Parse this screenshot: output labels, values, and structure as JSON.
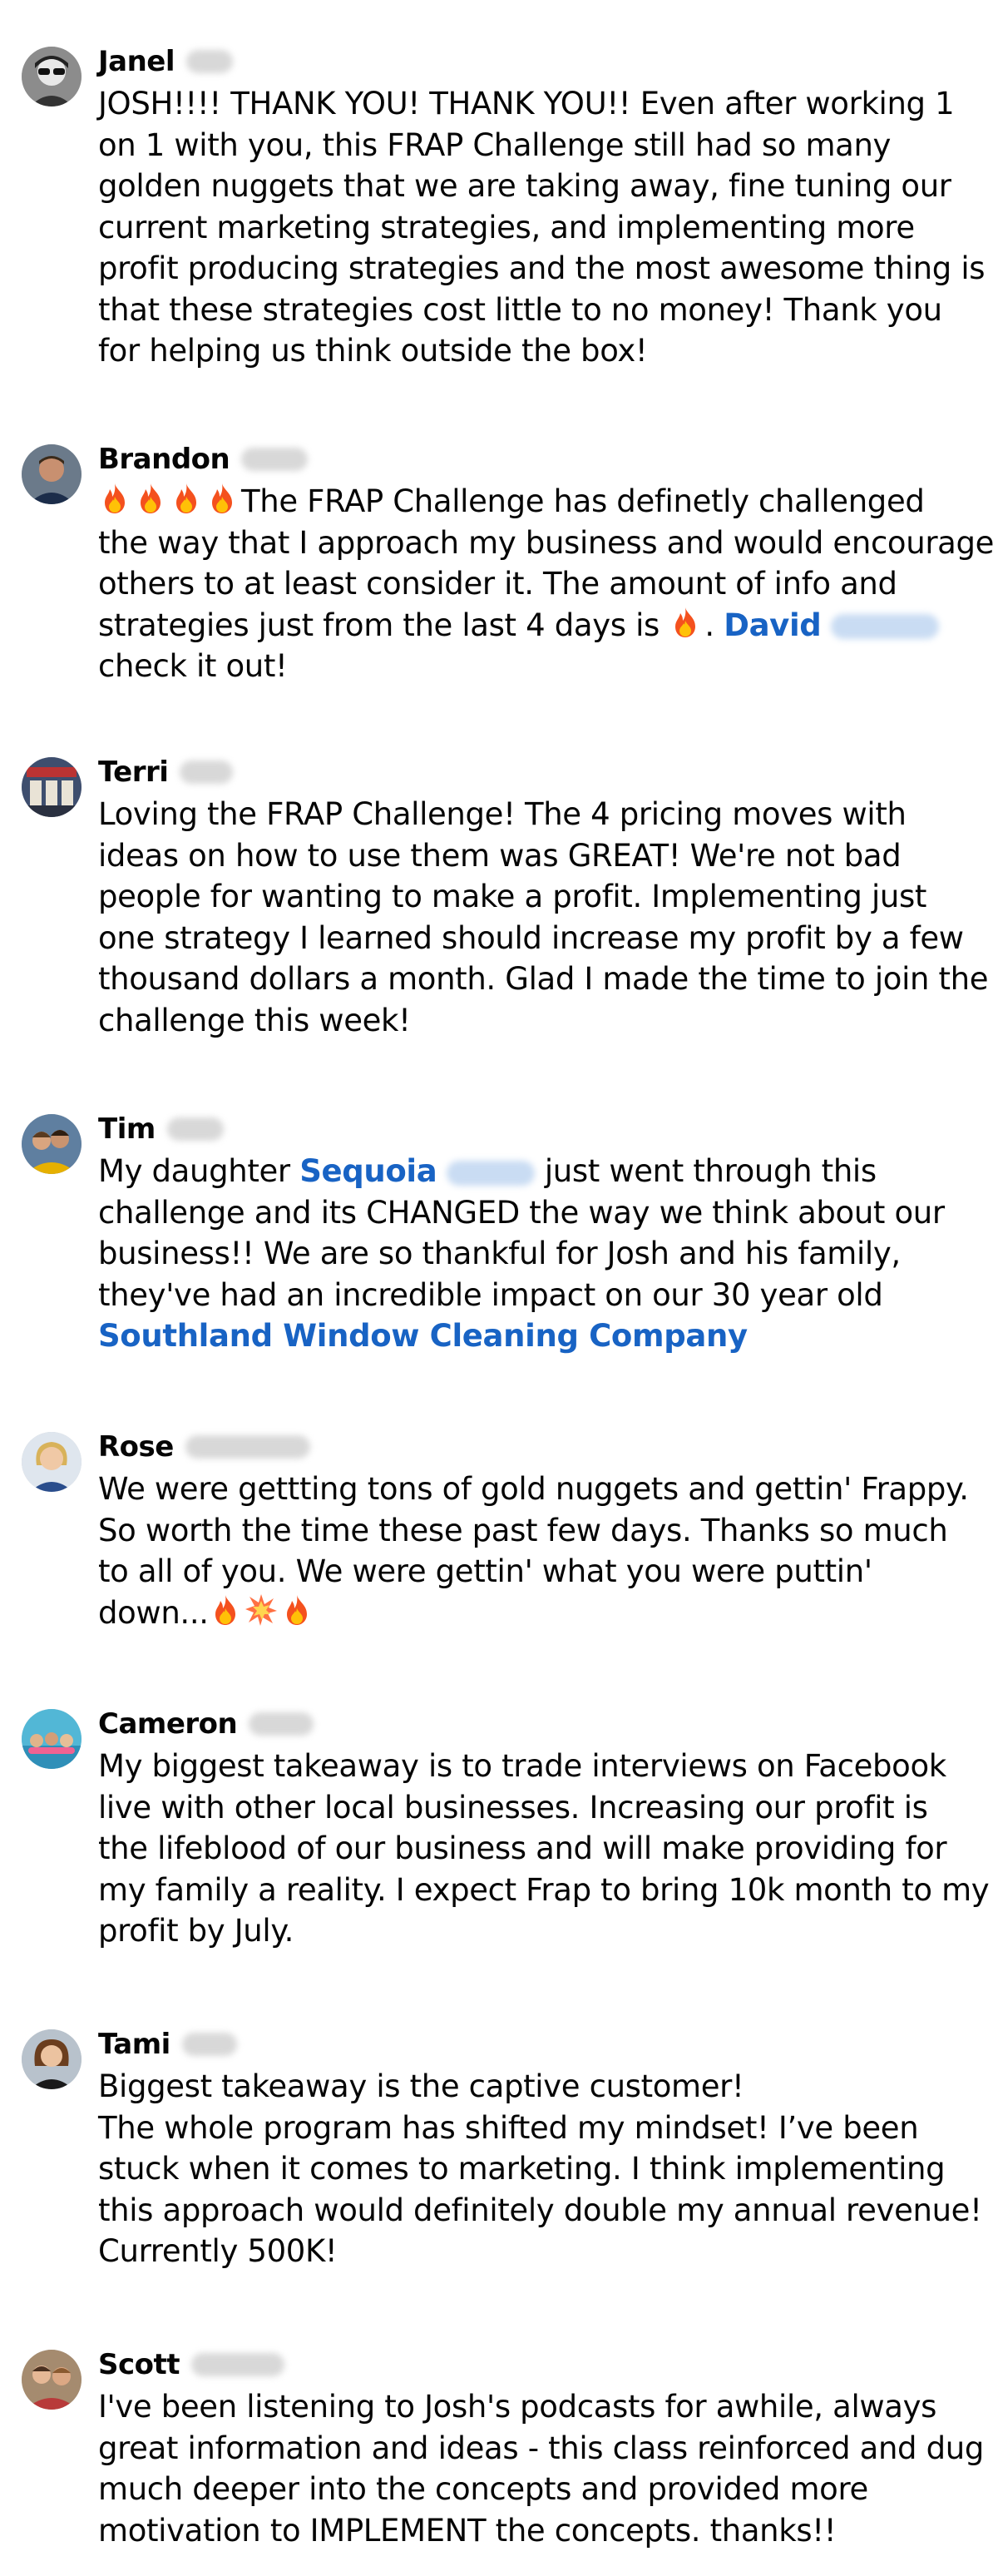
{
  "comments": [
    {
      "author": "Janel",
      "avatar": "avatar-sunglasses",
      "lines": [
        "JOSH!!!! THANK YOU! THANK YOU!! Even after working 1",
        "on 1 with you, this FRAP Challenge still had so many",
        "golden nuggets that we are taking away, fine tuning our",
        "current marketing strategies, and implementing more",
        "profit producing strategies and the most awesome thing is",
        "that these strategies cost little to no money! Thank you",
        "for helping us think outside the box!"
      ]
    },
    {
      "author": "Brandon",
      "avatar": "avatar-man",
      "line1_text": "The FRAP Challenge has definetly challenged",
      "line2": "the way that I approach my business and would encourage",
      "line3": "others to at least consider it. The amount of info and",
      "line4_text": "strategies just from the last 4 days is",
      "line4_period": ".",
      "mention": "David",
      "line5": "check it out!"
    },
    {
      "author": "Terri",
      "avatar": "avatar-store",
      "lines": [
        "Loving the FRAP Challenge! The 4 pricing moves with",
        "ideas on how to use them was GREAT! We're not bad",
        "people for wanting to make a profit. Implementing just",
        "one strategy I learned should increase my profit by a few",
        "thousand dollars a month. Glad I made the time to join the",
        "challenge this week!"
      ]
    },
    {
      "author": "Tim",
      "avatar": "avatar-family",
      "line1_before": "My daughter",
      "mention": "Sequoia",
      "line1_after": "just went through this",
      "line2": "challenge and its CHANGED the way we think about our",
      "line3": "business!! We are so thankful for Josh and his family,",
      "line4": "they've had an incredible impact on our 30 year old",
      "page_link": "Southland Window Cleaning Company"
    },
    {
      "author": "Rose",
      "avatar": "avatar-woman-blonde",
      "lines": [
        "We were gettting tons of gold nuggets and gettin'  Frappy.",
        "So worth the time these past few days.  Thanks so much",
        "to all of you.  We were gettin' what you were puttin'"
      ],
      "last_line_text": "down..."
    },
    {
      "author": "Cameron",
      "avatar": "avatar-group-pool",
      "lines": [
        "My biggest takeaway is to trade interviews on Facebook",
        "live with other local businesses. Increasing our profit is",
        "the lifeblood of our business and will make providing for",
        "my family a reality. I expect Frap to bring 10k month to my",
        "profit by July."
      ]
    },
    {
      "author": "Tami",
      "avatar": "avatar-woman-dark",
      "lines": [
        "Biggest takeaway is the captive customer!",
        "The whole program has shifted my mindset! I’ve been",
        "stuck when it comes to marketing. I think implementing",
        "this approach would definitely double my annual revenue!",
        "Currently 500K!"
      ]
    },
    {
      "author": "Scott",
      "avatar": "avatar-couple",
      "lines": [
        "I've been listening to Josh's podcasts for awhile, always",
        "great information and ideas - this class reinforced and dug",
        "much deeper into the concepts and provided more",
        "motivation to IMPLEMENT the concepts.  thanks!!"
      ]
    }
  ],
  "colors": {
    "text": "#050505",
    "link": "#1863c4",
    "fire": "#f4511e",
    "fire_inner": "#ffc107",
    "collision": "#ff7043"
  },
  "icons": [
    "fire-emoji",
    "collision-emoji"
  ]
}
